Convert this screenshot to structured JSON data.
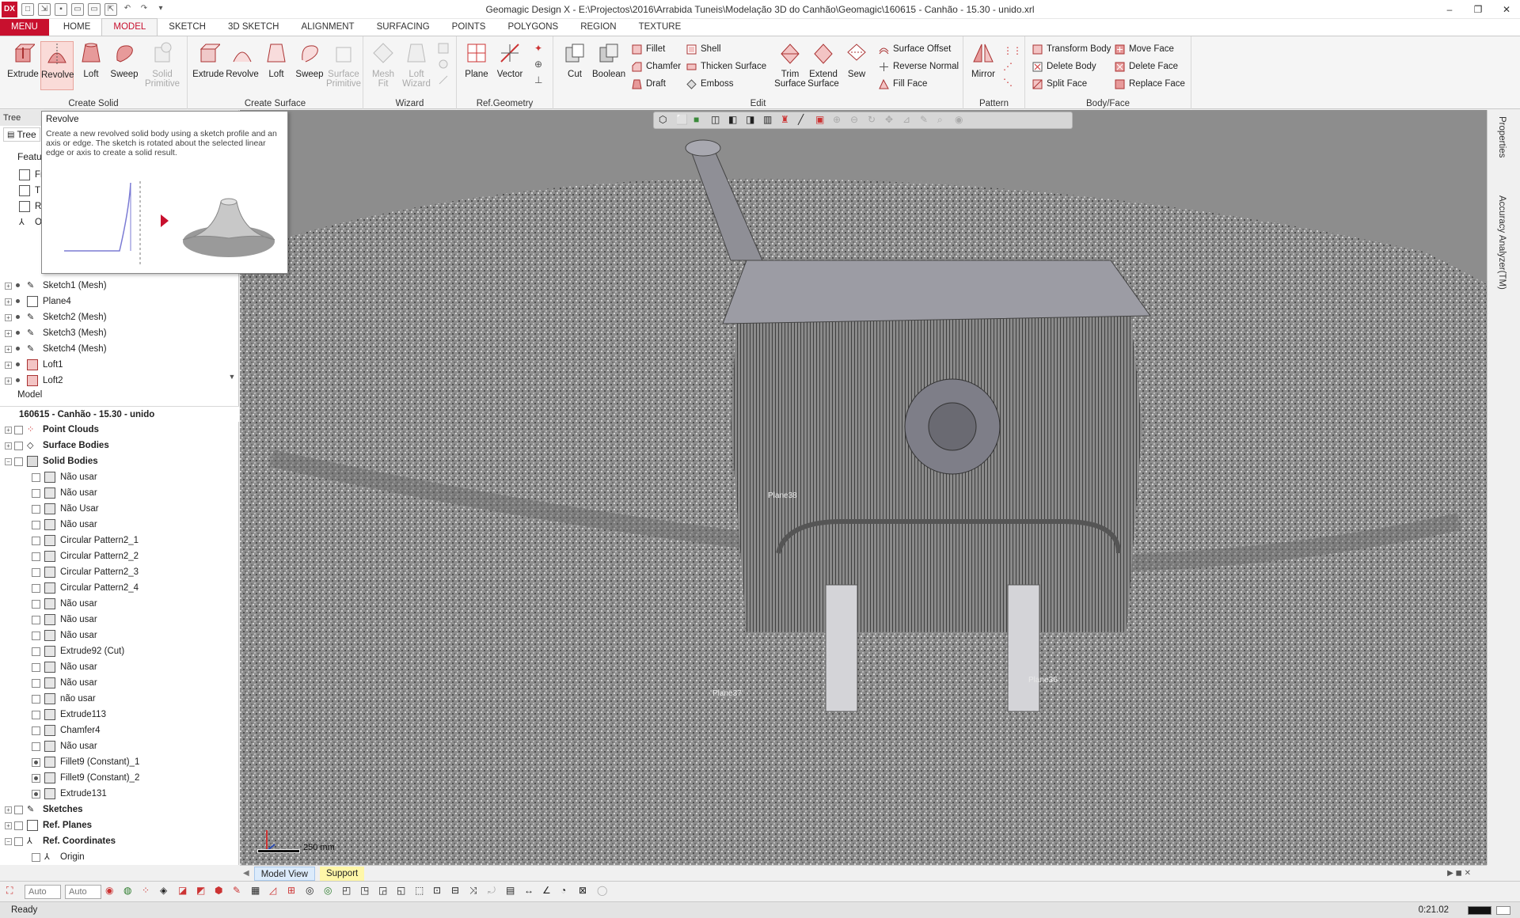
{
  "title_bar": {
    "app_abbr": "DX",
    "title": "Geomagic Design X - E:\\Projectos\\2016\\Arrabida Tuneis\\Modelação 3D do Canhão\\Geomagic\\160615 - Canhão - 15.30 - unido.xrl",
    "minimize": "–",
    "restore": "❐",
    "close": "✕"
  },
  "ribbon_tabs": [
    "MENU",
    "HOME",
    "MODEL",
    "SKETCH",
    "3D SKETCH",
    "ALIGNMENT",
    "SURFACING",
    "POINTS",
    "POLYGONS",
    "REGION",
    "TEXTURE"
  ],
  "ribbon": {
    "create_solid": {
      "label": "Create Solid",
      "buttons": [
        "Extrude",
        "Revolve",
        "Loft",
        "Sweep",
        "Solid\nPrimitive"
      ]
    },
    "create_surface": {
      "label": "Create Surface",
      "buttons": [
        "Extrude",
        "Revolve",
        "Loft",
        "Sweep",
        "Surface\nPrimitive"
      ]
    },
    "wizard": {
      "label": "Wizard",
      "buttons": [
        "Mesh\nFit",
        "Loft\nWizard"
      ]
    },
    "ref_geometry": {
      "label": "Ref.Geometry",
      "buttons": [
        "Plane",
        "Vector"
      ]
    },
    "edit": {
      "label": "Edit",
      "big": [
        "Cut",
        "Boolean",
        "Trim\nSurface",
        "Extend\nSurface",
        "Sew"
      ],
      "small": [
        "Fillet",
        "Chamfer",
        "Draft",
        "Shell",
        "Thicken Surface",
        "Emboss",
        "Surface Offset",
        "Reverse Normal",
        "Fill Face"
      ]
    },
    "pattern": {
      "label": "Pattern",
      "buttons": [
        "Mirror"
      ]
    },
    "body_face": {
      "label": "Body/Face",
      "small": [
        "Transform Body",
        "Delete Body",
        "Split Face",
        "Move Face",
        "Delete Face",
        "Replace Face"
      ]
    }
  },
  "tooltip": {
    "title": "Revolve",
    "description": "Create a new revolved solid body using a sketch profile and an axis or edge. The sketch is rotated about the selected linear edge or axis to create a solid result."
  },
  "left_panel": {
    "header": "Tree",
    "tab_tree": "Tree",
    "tab_feature": "Featu",
    "feature_tree_partial": [
      "Fr",
      "T",
      "R",
      "O"
    ],
    "feature_items": [
      "Sketch1 (Mesh)",
      "Plane4",
      "Sketch2 (Mesh)",
      "Sketch3 (Mesh)",
      "Sketch4 (Mesh)",
      "Loft1",
      "Loft2"
    ],
    "model_label": "Model",
    "document": "160615 - Canhão - 15.30 - unido",
    "model_tree": {
      "point_clouds": "Point Clouds",
      "surface_bodies": "Surface Bodies",
      "solid_bodies": "Solid Bodies",
      "solid_items": [
        "Não usar",
        "Não usar",
        "Não Usar",
        "Não usar",
        "Circular Pattern2_1",
        "Circular Pattern2_2",
        "Circular Pattern2_3",
        "Circular Pattern2_4",
        "Não usar",
        "Não usar",
        "Não usar",
        "Extrude92 (Cut)",
        "Não usar",
        "Não usar",
        "não usar",
        "Extrude113",
        "Chamfer4",
        "Não usar",
        "Fillet9 (Constant)_1",
        "Fillet9 (Constant)_2",
        "Extrude131"
      ],
      "sketches": "Sketches",
      "ref_planes": "Ref. Planes",
      "ref_coordinates": "Ref. Coordinates",
      "origin": "Origin"
    }
  },
  "viewport": {
    "labels": [
      "Plane38",
      "Plane37",
      "Plane36"
    ],
    "scale_text": "250 mm"
  },
  "right_panel": {
    "tabs": [
      "Properties",
      "Accuracy Analyzer(TM)"
    ]
  },
  "bottom_tabs": [
    "Model View",
    "Support"
  ],
  "bottom_toolbar": {
    "combo1": "Auto",
    "combo2": "Auto"
  },
  "status": {
    "text": "Ready",
    "time": "0:21.02"
  },
  "colors": {
    "accent": "#c8102e",
    "viewport_bg": "#8d8d8d",
    "ribbon_bg": "#f5f5f5"
  }
}
